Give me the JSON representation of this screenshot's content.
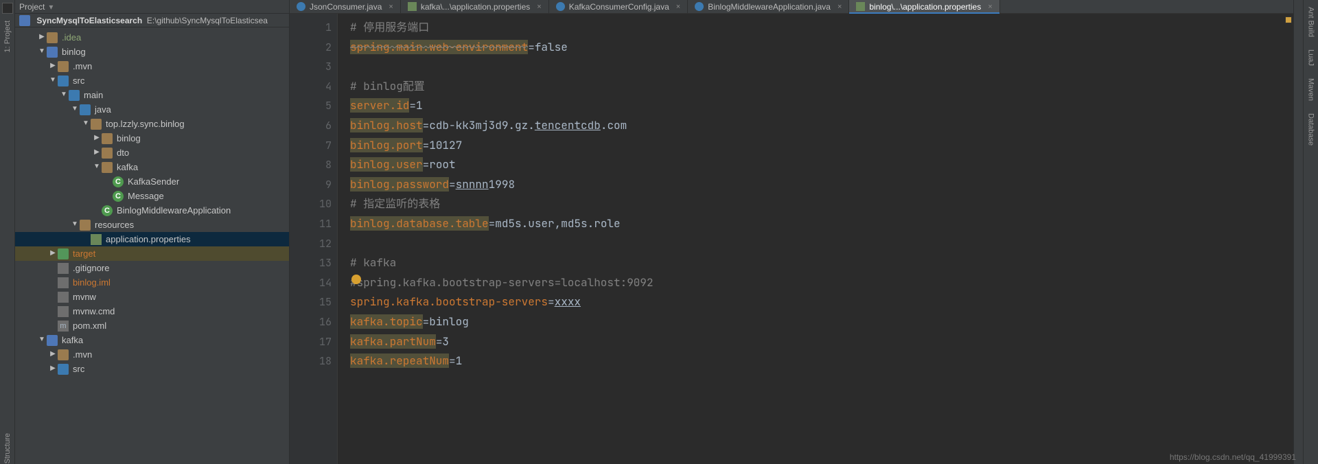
{
  "left_tools": {
    "project": "1: Project",
    "structure": "Structure"
  },
  "project_header": {
    "label": "Project"
  },
  "breadcrumb": {
    "name": "SyncMysqlToElasticsearch",
    "path": "E:\\github\\SyncMysqlToElasticsea"
  },
  "tree": [
    {
      "d": 1,
      "chev": "right",
      "ico": "dir",
      "lab": ".idea",
      "cls": "muted"
    },
    {
      "d": 1,
      "chev": "down",
      "ico": "module",
      "lab": "binlog"
    },
    {
      "d": 2,
      "chev": "right",
      "ico": "dir",
      "lab": ".mvn"
    },
    {
      "d": 2,
      "chev": "down",
      "ico": "dir-blue",
      "lab": "src"
    },
    {
      "d": 3,
      "chev": "down",
      "ico": "dir-blue",
      "lab": "main"
    },
    {
      "d": 4,
      "chev": "down",
      "ico": "dir-blue",
      "lab": "java"
    },
    {
      "d": 5,
      "chev": "down",
      "ico": "dir",
      "lab": "top.lzzly.sync.binlog"
    },
    {
      "d": 6,
      "chev": "right",
      "ico": "dir",
      "lab": "binlog"
    },
    {
      "d": 6,
      "chev": "right",
      "ico": "dir",
      "lab": "dto"
    },
    {
      "d": 6,
      "chev": "down",
      "ico": "dir",
      "lab": "kafka"
    },
    {
      "d": 7,
      "chev": "none",
      "ico": "circle",
      "lab": "KafkaSender",
      "glyph": "C"
    },
    {
      "d": 7,
      "chev": "none",
      "ico": "circle",
      "lab": "Message",
      "glyph": "C"
    },
    {
      "d": 6,
      "chev": "none",
      "ico": "circle",
      "lab": "BinlogMiddlewareApplication",
      "glyph": "C"
    },
    {
      "d": 4,
      "chev": "down",
      "ico": "dir",
      "lab": "resources"
    },
    {
      "d": 5,
      "chev": "none",
      "ico": "file",
      "lab": "application.properties",
      "sel": true
    },
    {
      "d": 2,
      "chev": "right",
      "ico": "dir-green",
      "lab": "target",
      "cls": "orange",
      "hl": true
    },
    {
      "d": 2,
      "chev": "none",
      "ico": "file-gray",
      "lab": ".gitignore"
    },
    {
      "d": 2,
      "chev": "none",
      "ico": "file-gray",
      "lab": "binlog.iml",
      "cls": "orange"
    },
    {
      "d": 2,
      "chev": "none",
      "ico": "file-gray",
      "lab": "mvnw"
    },
    {
      "d": 2,
      "chev": "none",
      "ico": "file-gray",
      "lab": "mvnw.cmd"
    },
    {
      "d": 2,
      "chev": "none",
      "ico": "file-gray",
      "lab": "pom.xml",
      "glyph": "m"
    },
    {
      "d": 1,
      "chev": "down",
      "ico": "module",
      "lab": "kafka"
    },
    {
      "d": 2,
      "chev": "right",
      "ico": "dir",
      "lab": ".mvn"
    },
    {
      "d": 2,
      "chev": "right",
      "ico": "dir-blue",
      "lab": "src"
    }
  ],
  "tabs": [
    {
      "ico": "java",
      "lab": "JsonConsumer.java"
    },
    {
      "ico": "prop",
      "lab": "kafka\\...\\application.properties"
    },
    {
      "ico": "java",
      "lab": "KafkaConsumerConfig.java"
    },
    {
      "ico": "java",
      "lab": "BinlogMiddlewareApplication.java"
    },
    {
      "ico": "prop",
      "lab": "binlog\\...\\application.properties",
      "active": true
    }
  ],
  "code": {
    "lines": [
      {
        "n": 1,
        "segs": [
          {
            "t": "# 停用服务端口",
            "cls": "c"
          }
        ]
      },
      {
        "n": 2,
        "segs": [
          {
            "t": "spring.main.web-environment",
            "cls": "k strike warn"
          },
          {
            "t": "=",
            "cls": "v"
          },
          {
            "t": "false",
            "cls": "v"
          }
        ]
      },
      {
        "n": 3,
        "segs": []
      },
      {
        "n": 4,
        "segs": [
          {
            "t": "# binlog配置",
            "cls": "c"
          }
        ]
      },
      {
        "n": 5,
        "segs": [
          {
            "t": "server.id",
            "cls": "k warn"
          },
          {
            "t": "=",
            "cls": "v"
          },
          {
            "t": "1",
            "cls": "v"
          }
        ]
      },
      {
        "n": 6,
        "segs": [
          {
            "t": "binlog.host",
            "cls": "k warn"
          },
          {
            "t": "=",
            "cls": "v"
          },
          {
            "t": "cdb-kk3mj3d9.gz.",
            "cls": "v"
          },
          {
            "t": "tencentcdb",
            "cls": "v uline"
          },
          {
            "t": ".com",
            "cls": "v"
          }
        ]
      },
      {
        "n": 7,
        "segs": [
          {
            "t": "binlog.port",
            "cls": "k warn"
          },
          {
            "t": "=",
            "cls": "v"
          },
          {
            "t": "10127",
            "cls": "v"
          }
        ]
      },
      {
        "n": 8,
        "segs": [
          {
            "t": "binlog.user",
            "cls": "k warn"
          },
          {
            "t": "=",
            "cls": "v"
          },
          {
            "t": "root",
            "cls": "v"
          }
        ]
      },
      {
        "n": 9,
        "segs": [
          {
            "t": "binlog.password",
            "cls": "k warn"
          },
          {
            "t": "=",
            "cls": "v"
          },
          {
            "t": "snnnn",
            "cls": "v uline"
          },
          {
            "t": "1998",
            "cls": "v"
          }
        ]
      },
      {
        "n": 10,
        "segs": [
          {
            "t": "# 指定监听的表格",
            "cls": "c"
          }
        ]
      },
      {
        "n": 11,
        "segs": [
          {
            "t": "binlog.database.table",
            "cls": "k warn"
          },
          {
            "t": "=",
            "cls": "v"
          },
          {
            "t": "md5s.user,md5s.role",
            "cls": "v"
          }
        ]
      },
      {
        "n": 12,
        "segs": []
      },
      {
        "n": 13,
        "segs": [
          {
            "t": "# kafka",
            "cls": "c"
          }
        ]
      },
      {
        "n": 14,
        "bulb": true,
        "segs": [
          {
            "t": "#",
            "cls": "c"
          },
          {
            "t": "spring.kafka.bootstrap-servers=localhost:9092",
            "cls": "c"
          }
        ]
      },
      {
        "n": 15,
        "cur": true,
        "segs": [
          {
            "t": "spring.kafka.bootstrap-servers",
            "cls": "k"
          },
          {
            "t": "=",
            "cls": "v"
          },
          {
            "t": "xxxx",
            "cls": "v uline"
          }
        ]
      },
      {
        "n": 16,
        "segs": [
          {
            "t": "kafka.topic",
            "cls": "k warn"
          },
          {
            "t": "=",
            "cls": "v"
          },
          {
            "t": "binlog",
            "cls": "v"
          }
        ]
      },
      {
        "n": 17,
        "segs": [
          {
            "t": "kafka.partNum",
            "cls": "k warn"
          },
          {
            "t": "=",
            "cls": "v"
          },
          {
            "t": "3",
            "cls": "v"
          }
        ]
      },
      {
        "n": 18,
        "segs": [
          {
            "t": "kafka.repeatNum",
            "cls": "k warn"
          },
          {
            "t": "=",
            "cls": "v"
          },
          {
            "t": "1",
            "cls": "v"
          }
        ]
      }
    ]
  },
  "right_tools": {
    "ant": "Ant Build",
    "lua": "LuaJ",
    "maven": "Maven",
    "db": "Database"
  },
  "status": {
    "url": "https://blog.csdn.net/qq_41999391"
  }
}
